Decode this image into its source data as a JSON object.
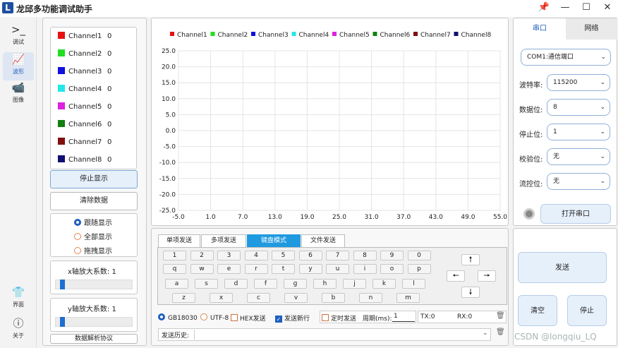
{
  "app": {
    "logo": "L",
    "title": "龙邱多功能调试助手"
  },
  "window": {
    "pin": "📌",
    "min": "—",
    "max": "☐",
    "close": "✕"
  },
  "nav": [
    {
      "icon": ">_",
      "label": "调试"
    },
    {
      "icon": "📈",
      "label": "波形"
    },
    {
      "icon": "📹",
      "label": "图像"
    },
    {
      "icon": "👕",
      "label": "界面"
    },
    {
      "icon": "ⓘ",
      "label": "关于"
    }
  ],
  "channels": [
    {
      "name": "Channel1",
      "value": "0",
      "color": "#e81010"
    },
    {
      "name": "Channel2",
      "value": "0",
      "color": "#22dd22"
    },
    {
      "name": "Channel3",
      "value": "0",
      "color": "#1010e0"
    },
    {
      "name": "Channel4",
      "value": "0",
      "color": "#22e8e8"
    },
    {
      "name": "Channel5",
      "value": "0",
      "color": "#e020e0"
    },
    {
      "name": "Channel6",
      "value": "0",
      "color": "#108010"
    },
    {
      "name": "Channel7",
      "value": "0",
      "color": "#801010"
    },
    {
      "name": "Channel8",
      "value": "0",
      "color": "#101070"
    }
  ],
  "buttons": {
    "stop_display": "停止显示",
    "clear_data": "清除数据",
    "protocol": "数据解析协议"
  },
  "display_modes": [
    {
      "label": "跟随显示",
      "selected": true
    },
    {
      "label": "全部显示",
      "selected": false
    },
    {
      "label": "拖拽显示",
      "selected": false
    }
  ],
  "zoom": {
    "x_label": "x轴放大系数:",
    "x_value": "1",
    "y_label": "y轴放大系数:",
    "y_value": "1"
  },
  "chart_data": {
    "type": "line",
    "legend": [
      "Channel1",
      "Channel2",
      "Channel3",
      "Channel4",
      "Channel5",
      "Channel6",
      "Channel7",
      "Channel8"
    ],
    "legend_colors": [
      "#e81010",
      "#22dd22",
      "#1010e0",
      "#22e8e8",
      "#e020e0",
      "#108010",
      "#801010",
      "#101070"
    ],
    "series": [],
    "xticks": [
      "-5.0",
      "1.0",
      "7.0",
      "13.0",
      "19.0",
      "25.0",
      "31.0",
      "37.0",
      "43.0",
      "49.0",
      "55.0"
    ],
    "yticks": [
      "25.0",
      "20.0",
      "15.0",
      "10.0",
      "5.0",
      "0.0",
      "-5.0",
      "-10.0",
      "-15.0",
      "-20.0",
      "-25.0"
    ],
    "xlim": [
      -5,
      55
    ],
    "ylim": [
      -25,
      25
    ],
    "grid": true,
    "legend_position": "top"
  },
  "tabs": [
    "单项发送",
    "多项发送",
    "键盘模式",
    "文件发送"
  ],
  "keyboard": {
    "row1": [
      "1",
      "2",
      "3",
      "4",
      "5",
      "6",
      "7",
      "8",
      "9",
      "0"
    ],
    "row2": [
      "q",
      "w",
      "e",
      "r",
      "t",
      "y",
      "u",
      "i",
      "o",
      "p"
    ],
    "row3": [
      "a",
      "s",
      "d",
      "f",
      "g",
      "h",
      "j",
      "k",
      "l"
    ],
    "row4": [
      "z",
      "x",
      "c",
      "v",
      "b",
      "n",
      "m"
    ],
    "arrows": {
      "up": "🠕",
      "left": "🠔",
      "right": "🠖",
      "down": "🠗"
    }
  },
  "encoding": {
    "gb": "GB18030",
    "utf": "UTF-8",
    "hex": "HEX发送",
    "newline": "发送新行",
    "timer": "定时发送",
    "period_label": "周期(ms):",
    "period_value": "1",
    "tx": "TX:0",
    "rx": "RX:0"
  },
  "history": {
    "label": "发送历史:"
  },
  "right": {
    "tab_serial": "串口",
    "tab_network": "网络",
    "port": "COM1:通信端口",
    "fields": [
      {
        "label": "波特率:",
        "value": "115200"
      },
      {
        "label": "数据位:",
        "value": "8"
      },
      {
        "label": "停止位:",
        "value": "1"
      },
      {
        "label": "校验位:",
        "value": "无"
      },
      {
        "label": "流控位:",
        "value": "无"
      }
    ],
    "open_port": "打开串口",
    "send": "发送",
    "clear": "清空",
    "stop": "停止"
  },
  "watermark": "CSDN @longqiu_LQ"
}
